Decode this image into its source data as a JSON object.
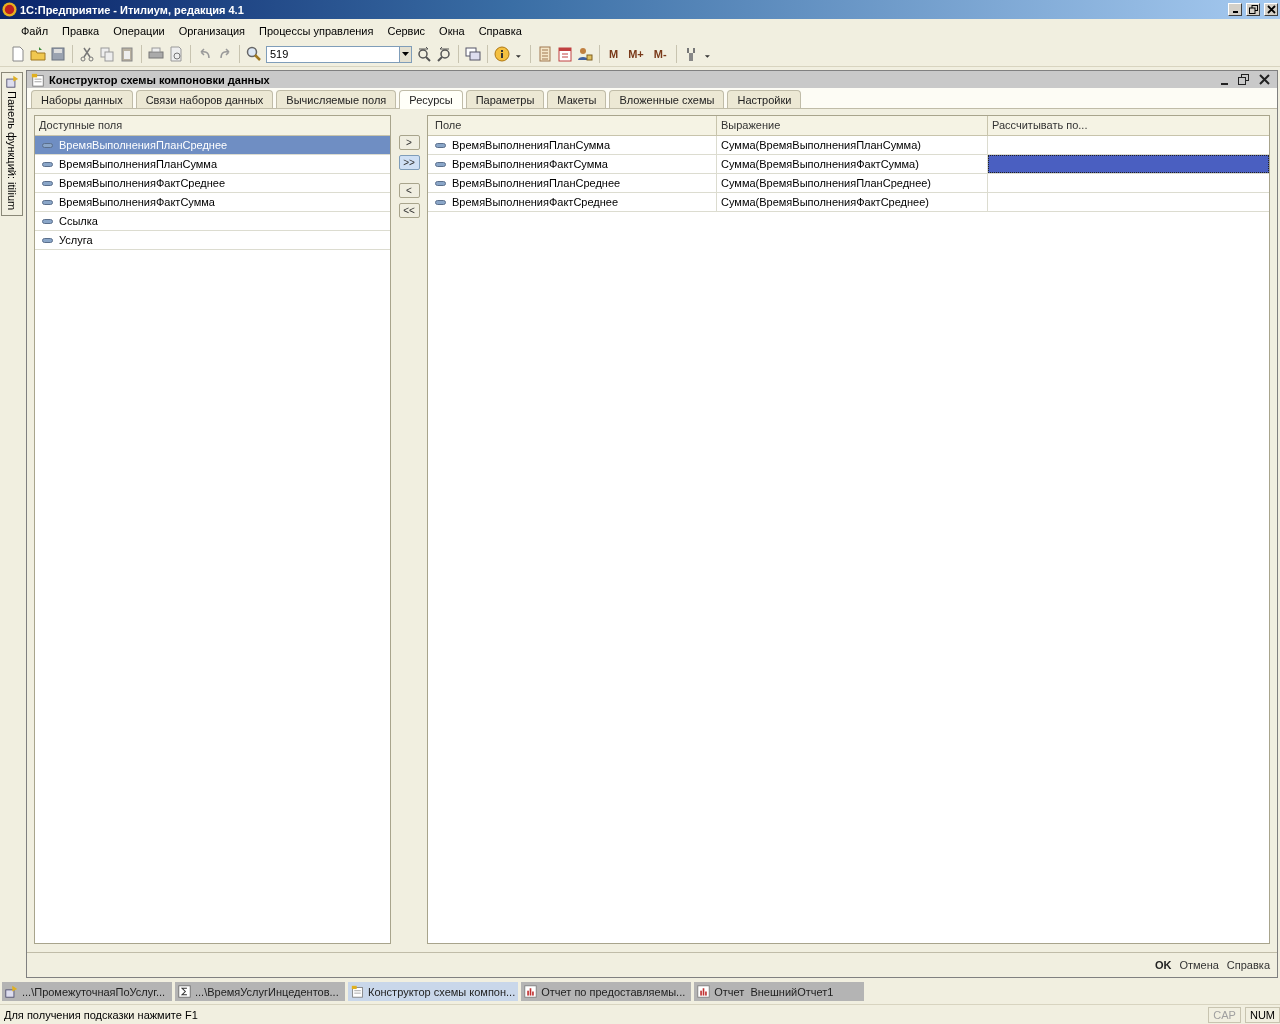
{
  "window": {
    "title": "1С:Предприятие - Итилиум, редакция 4.1"
  },
  "menu": [
    "Файл",
    "Правка",
    "Операции",
    "Организация",
    "Процессы управления",
    "Сервис",
    "Окна",
    "Справка"
  ],
  "toolbar": {
    "search_value": "519",
    "memory_buttons": [
      "M",
      "M+",
      "M-"
    ]
  },
  "side_panel": {
    "label": "Панель функций: itilium"
  },
  "form": {
    "title": "Конструктор схемы компоновки данных",
    "tabs": [
      {
        "label": "Наборы данных",
        "selected": false
      },
      {
        "label": "Связи наборов данных",
        "selected": false
      },
      {
        "label": "Вычисляемые поля",
        "selected": false
      },
      {
        "label": "Ресурсы",
        "selected": true
      },
      {
        "label": "Параметры",
        "selected": false
      },
      {
        "label": "Макеты",
        "selected": false
      },
      {
        "label": "Вложенные схемы",
        "selected": false
      },
      {
        "label": "Настройки",
        "selected": false
      }
    ],
    "available_fields": {
      "header": "Доступные поля",
      "items": [
        {
          "label": "ВремяВыполненияПланСреднее",
          "selected": true
        },
        {
          "label": "ВремяВыполненияПланСумма",
          "selected": false
        },
        {
          "label": "ВремяВыполненияФактСреднее",
          "selected": false
        },
        {
          "label": "ВремяВыполненияФактСумма",
          "selected": false
        },
        {
          "label": "Ссылка",
          "selected": false
        },
        {
          "label": "Услуга",
          "selected": false
        }
      ]
    },
    "move_buttons": [
      {
        "label": ">",
        "focused": false
      },
      {
        "label": ">>",
        "focused": true
      },
      {
        "label": "<",
        "focused": false
      },
      {
        "label": "<<",
        "focused": false
      }
    ],
    "resources": {
      "columns": [
        "Поле",
        "Выражение",
        "Рассчитывать по..."
      ],
      "rows": [
        {
          "field": "ВремяВыполненияПланСумма",
          "expression": "Сумма(ВремяВыполненияПланСумма)",
          "calc_selected": false
        },
        {
          "field": "ВремяВыполненияФактСумма",
          "expression": "Сумма(ВремяВыполненияФактСумма)",
          "calc_selected": true
        },
        {
          "field": "ВремяВыполненияПланСреднее",
          "expression": "Сумма(ВремяВыполненияПланСреднее)",
          "calc_selected": false
        },
        {
          "field": "ВремяВыполненияФактСреднее",
          "expression": "Сумма(ВремяВыполненияФактСреднее)",
          "calc_selected": false
        }
      ]
    },
    "buttons": [
      {
        "label": "OK",
        "default": true
      },
      {
        "label": "Отмена",
        "default": false
      },
      {
        "label": "Справка",
        "default": false
      }
    ]
  },
  "taskbar": [
    {
      "label": "...\\ПромежуточнаяПоУслуг...",
      "kind": "process",
      "selected": false
    },
    {
      "label": "...\\ВремяУслугИнцедентов...",
      "kind": "sum",
      "selected": false
    },
    {
      "label": "Конструктор схемы компон...",
      "kind": "form",
      "selected": true
    },
    {
      "label": "Отчет по предоставляемы...",
      "kind": "report",
      "selected": false
    },
    {
      "label": "Отчет  ВнешнийОтчет1",
      "kind": "report",
      "selected": false
    }
  ],
  "status_bar": {
    "text": "Для получения подсказки нажмите F1",
    "indicators": [
      {
        "label": "CAP",
        "on": false
      },
      {
        "label": "NUM",
        "on": true
      }
    ]
  }
}
